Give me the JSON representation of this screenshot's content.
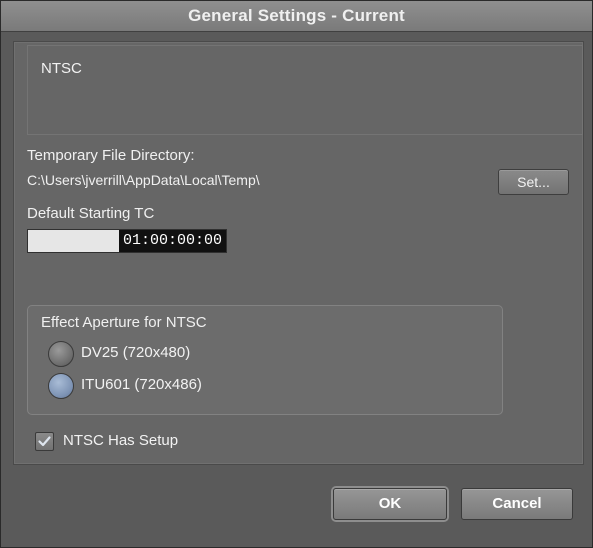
{
  "window": {
    "title": "General Settings - Current"
  },
  "video_format": {
    "value": "NTSC"
  },
  "temp_dir": {
    "label": "Temporary File Directory:",
    "path": "C:\\Users\\jverrill\\AppData\\Local\\Temp\\",
    "set_button_label": "Set..."
  },
  "starting_tc": {
    "label": "Default Starting TC",
    "value": "01:00:00:00"
  },
  "aperture": {
    "title": "Effect Aperture for NTSC",
    "options": [
      {
        "label": "DV25 (720x480)",
        "selected": false
      },
      {
        "label": "ITU601 (720x486)",
        "selected": true
      }
    ]
  },
  "setup": {
    "label": "NTSC Has Setup",
    "checked": true
  },
  "buttons": {
    "ok": "OK",
    "cancel": "Cancel"
  },
  "colors": {
    "window_bg": "#5a5a5a",
    "panel_bg": "#666666",
    "radio_selected": "#7d93b4",
    "text": "#f0f0f0"
  },
  "icons": {
    "checkbox_mark": "checkmark-icon"
  }
}
